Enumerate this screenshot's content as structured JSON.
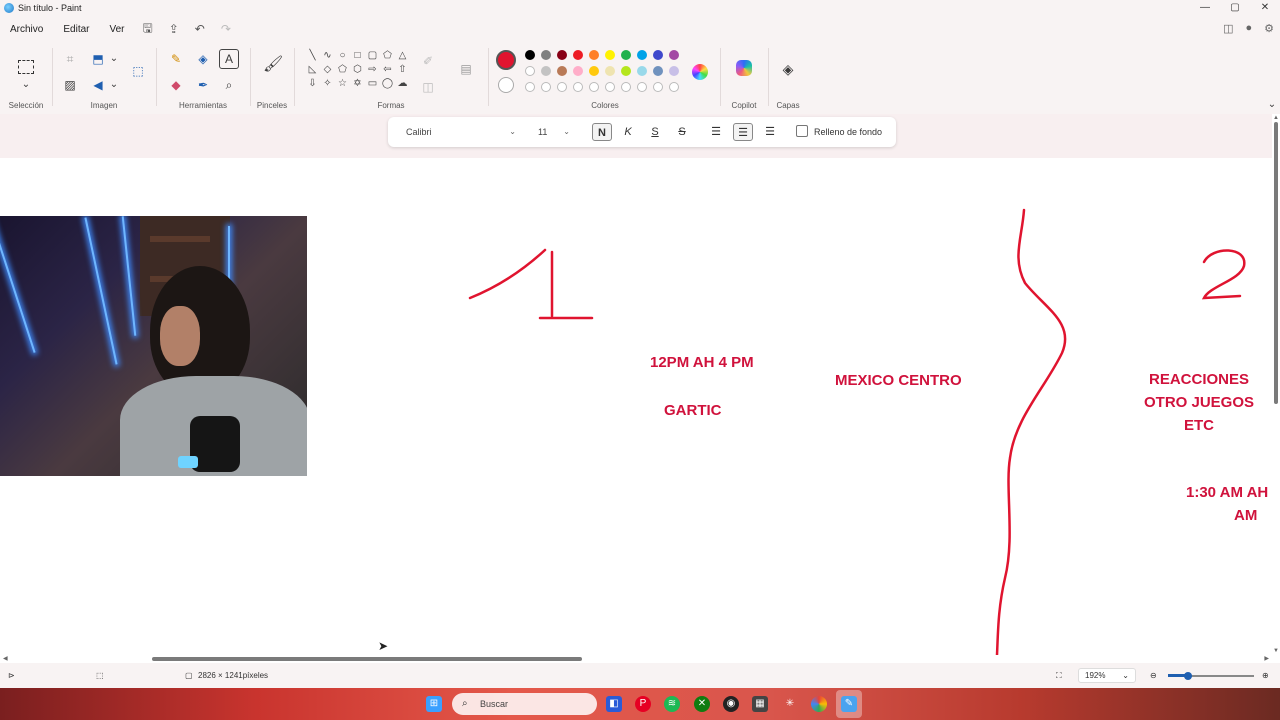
{
  "window": {
    "title": "Sin título - Paint",
    "controls": [
      "—",
      "▢",
      "✕"
    ]
  },
  "menu": {
    "items": [
      "Archivo",
      "Editar",
      "Ver"
    ]
  },
  "ribbon": {
    "groups": [
      "Selección",
      "Imagen",
      "Herramientas",
      "Pinceles",
      "Formas",
      "Colores",
      "Copilot",
      "Capas"
    ],
    "active_color": "#e0142f",
    "palette_row1": [
      "#000000",
      "#7f7f7f",
      "#880015",
      "#ed1c24",
      "#ff7f27",
      "#fff200",
      "#22b14c",
      "#00a2e8",
      "#3f48cc",
      "#a349a4"
    ],
    "palette_row2": [
      "#ffffff",
      "#c3c3c3",
      "#b97a57",
      "#ffaec9",
      "#ffc90e",
      "#efe4b0",
      "#b5e61d",
      "#99d9ea",
      "#7092be",
      "#c8bfe7"
    ]
  },
  "text_toolbar": {
    "font": "Calibri",
    "size": "11",
    "bold": "N",
    "italic": "K",
    "underline": "S",
    "strike": "S",
    "fill_label": "Relleno de fondo"
  },
  "canvas": {
    "num_1": "1",
    "num_2": "2",
    "time1": "12PM AH 4 PM",
    "game1": "GARTIC",
    "center": "MEXICO CENTRO",
    "right_line1": "REACCIONES",
    "right_line2": "OTRO JUEGOS",
    "right_line3": "ETC",
    "time2_line1": "1:30 AM AH",
    "time2_line2": "AM",
    "stroke_color": "#e0142f"
  },
  "status": {
    "dimensions": "2826 × 1241píxeles",
    "zoom": "192%"
  },
  "taskbar": {
    "search_placeholder": "Buscar"
  }
}
